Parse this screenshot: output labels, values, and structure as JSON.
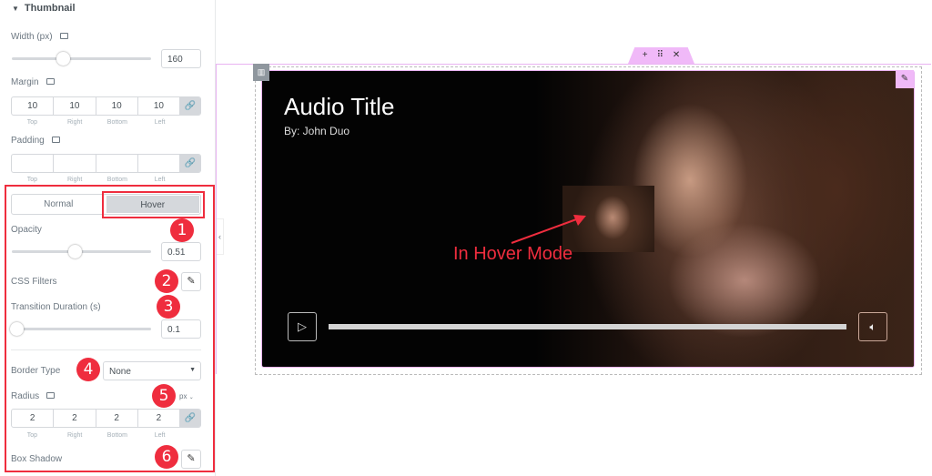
{
  "panel": {
    "section_title": "Thumbnail",
    "width": {
      "label": "Width (px)",
      "value": "160",
      "slider_fraction": 0.37
    },
    "margin": {
      "label": "Margin",
      "values": [
        "10",
        "10",
        "10",
        "10"
      ],
      "sub_labels": [
        "Top",
        "Right",
        "Bottom",
        "Left"
      ]
    },
    "padding": {
      "label": "Padding",
      "values": [
        "",
        "",
        "",
        ""
      ],
      "sub_labels": [
        "Top",
        "Right",
        "Bottom",
        "Left"
      ]
    },
    "tabs": {
      "normal": "Normal",
      "hover": "Hover",
      "active": "Hover"
    },
    "opacity": {
      "label": "Opacity",
      "value": "0.51",
      "slider_fraction": 0.51
    },
    "css_filters": {
      "label": "CSS Filters"
    },
    "transition": {
      "label": "Transition Duration (s)",
      "value": "0.1",
      "slider_fraction": 0.0
    },
    "border_type": {
      "label": "Border Type",
      "value": "None"
    },
    "radius": {
      "label": "Radius",
      "unit": "px",
      "values": [
        "2",
        "2",
        "2",
        "2"
      ],
      "sub_labels": [
        "Top",
        "Right",
        "Bottom",
        "Left"
      ]
    },
    "box_shadow": {
      "label": "Box Shadow"
    },
    "callouts": [
      "1",
      "2",
      "3",
      "4",
      "5",
      "6"
    ],
    "highlight_color": "#ef2d3e"
  },
  "preview": {
    "title": "Audio Title",
    "author": "By: John Duo",
    "annotation": "In Hover Mode",
    "progress_fraction": 1.0,
    "handle_icons": [
      "plus-icon",
      "drag-icon",
      "close-icon"
    ]
  }
}
